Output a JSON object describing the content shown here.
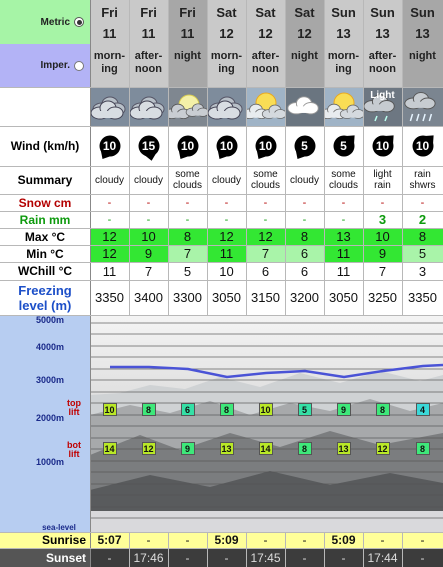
{
  "units": {
    "metric_label": "Metric",
    "imperial_label": "Imper.",
    "selected": "metric"
  },
  "columns": [
    {
      "day": "Fri",
      "date": "11",
      "period": [
        "morn-",
        "ing"
      ],
      "icon": "cloudy-icon",
      "wind": "10",
      "wind_dir": "ccw",
      "summary": [
        "cloudy"
      ],
      "snow": "-",
      "rain": "-",
      "max": "12",
      "min": "12",
      "wchill": "11",
      "freezing": "3350",
      "top_lift": "10",
      "bot_lift": "14"
    },
    {
      "day": "Fri",
      "date": "11",
      "period": [
        "after-",
        "noon"
      ],
      "icon": "cloudy-icon",
      "wind": "15",
      "wind_dir": "down",
      "summary": [
        "cloudy"
      ],
      "snow": "-",
      "rain": "-",
      "max": "10",
      "min": "9",
      "wchill": "7",
      "freezing": "3400",
      "top_lift": "8",
      "bot_lift": "12"
    },
    {
      "day": "Fri",
      "date": "11",
      "period": [
        "night"
      ],
      "icon": "moon-clouds-icon",
      "wind": "10",
      "wind_dir": "ccw",
      "summary": [
        "some",
        "clouds"
      ],
      "snow": "-",
      "rain": "-",
      "max": "8",
      "min": "7",
      "wchill": "5",
      "freezing": "3300",
      "top_lift": "6",
      "bot_lift": "9"
    },
    {
      "day": "Sat",
      "date": "12",
      "period": [
        "morn-",
        "ing"
      ],
      "icon": "cloudy-icon",
      "wind": "10",
      "wind_dir": "ccw",
      "summary": [
        "cloudy"
      ],
      "snow": "-",
      "rain": "-",
      "max": "12",
      "min": "11",
      "wchill": "10",
      "freezing": "3050",
      "top_lift": "8",
      "bot_lift": "13"
    },
    {
      "day": "Sat",
      "date": "12",
      "period": [
        "after-",
        "noon"
      ],
      "icon": "sun-clouds-icon",
      "wind": "10",
      "wind_dir": "ccw",
      "summary": [
        "some",
        "clouds"
      ],
      "snow": "-",
      "rain": "-",
      "max": "12",
      "min": "7",
      "wchill": "6",
      "freezing": "3150",
      "top_lift": "10",
      "bot_lift": "14"
    },
    {
      "day": "Sat",
      "date": "12",
      "period": [
        "night"
      ],
      "icon": "white-cloud-icon",
      "wind": "5",
      "wind_dir": "ccw",
      "summary": [
        "cloudy"
      ],
      "snow": "-",
      "rain": "-",
      "max": "8",
      "min": "6",
      "wchill": "6",
      "freezing": "3200",
      "top_lift": "5",
      "bot_lift": "8"
    },
    {
      "day": "Sun",
      "date": "13",
      "period": [
        "morn-",
        "ing"
      ],
      "icon": "sun-clouds-icon",
      "wind": "5",
      "wind_dir": "ne",
      "summary": [
        "some",
        "clouds"
      ],
      "snow": "-",
      "rain": "-",
      "max": "13",
      "min": "11",
      "wchill": "11",
      "freezing": "3050",
      "top_lift": "9",
      "bot_lift": "13"
    },
    {
      "day": "Sun",
      "date": "13",
      "period": [
        "after-",
        "noon"
      ],
      "icon": "light-rain-icon",
      "icon_text": "Light",
      "wind": "10",
      "wind_dir": "ne",
      "summary": [
        "light",
        "rain"
      ],
      "snow": "-",
      "rain": "3",
      "max": "10",
      "min": "9",
      "wchill": "7",
      "freezing": "3250",
      "top_lift": "8",
      "bot_lift": "12"
    },
    {
      "day": "Sun",
      "date": "13",
      "period": [
        "night"
      ],
      "icon": "rain-showers-icon",
      "wind": "10",
      "wind_dir": "ne",
      "summary": [
        "rain",
        "shwrs"
      ],
      "snow": "-",
      "rain": "2",
      "max": "8",
      "min": "5",
      "wchill": "3",
      "freezing": "3350",
      "top_lift": "4",
      "bot_lift": "8"
    }
  ],
  "row_labels": {
    "wind": "Wind (km/h)",
    "summary": "Summary",
    "snow": "Snow cm",
    "rain": "Rain mm",
    "max": "Max °C",
    "min": "Min °C",
    "wchill": "WChill °C",
    "freezing": [
      "Freezing",
      "level (m)"
    ],
    "top": [
      "top",
      "lift"
    ],
    "bot": [
      "bot",
      "lift"
    ],
    "sunrise": "Sunrise",
    "sunset": "Sunset"
  },
  "altitudes": [
    "5000m",
    "4000m",
    "3000m",
    "2000m",
    "1000m",
    "sea-level"
  ],
  "sunrise": [
    "5:07",
    "-",
    "-",
    "5:09",
    "-",
    "-",
    "5:09",
    "-",
    "-"
  ],
  "sunset": [
    "-",
    "17:46",
    "-",
    "-",
    "17:45",
    "-",
    "-",
    "17:44",
    "-"
  ],
  "colors": {
    "header_bg": "#c9c9c9",
    "header_night": "#a7a7a7",
    "metric_bg": "#a6f4a6",
    "imperial_bg": "#b3b3f6",
    "left_bg": "#b7cdf1",
    "green": "#33e733",
    "light_green": "#a9f4a9",
    "freezing_blue": "#1c4fc8",
    "snow_red": "#b30000",
    "rain_green": "#0d9a0d",
    "sunrise_bg": "#ffff99"
  }
}
